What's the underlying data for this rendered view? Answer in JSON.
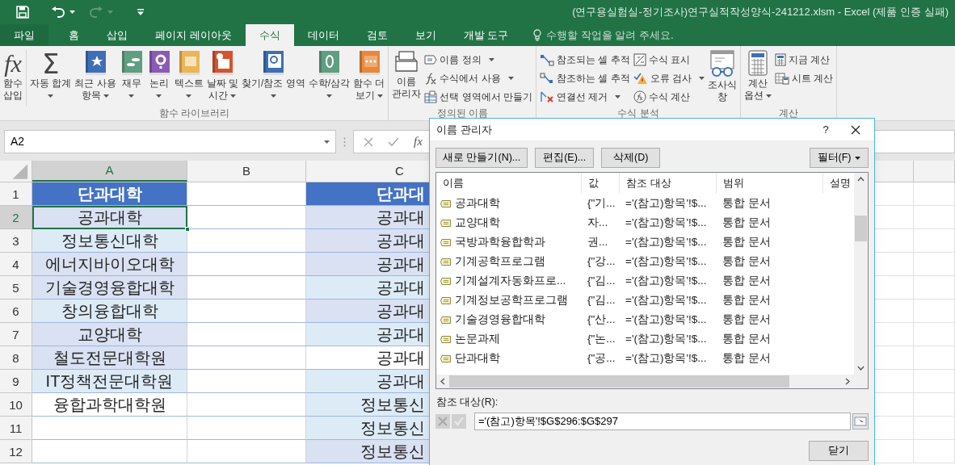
{
  "title_bar": {
    "title": "(연구용실험실-정기조사)연구실적작성양식-241212.xlsm - Excel (제품 인증 실패)"
  },
  "ribbon_tabs": [
    {
      "label": "파일",
      "kind": "file",
      "selected": false
    },
    {
      "label": "홈",
      "kind": "tab",
      "selected": false
    },
    {
      "label": "삽입",
      "kind": "tab",
      "selected": false
    },
    {
      "label": "페이지 레이아웃",
      "kind": "tab",
      "selected": false
    },
    {
      "label": "수식",
      "kind": "tab",
      "selected": true
    },
    {
      "label": "데이터",
      "kind": "tab",
      "selected": false
    },
    {
      "label": "검토",
      "kind": "tab",
      "selected": false
    },
    {
      "label": "보기",
      "kind": "tab",
      "selected": false
    },
    {
      "label": "개발 도구",
      "kind": "tab",
      "selected": false
    }
  ],
  "tell_me": {
    "placeholder": "수행할 작업을 알려 주세요."
  },
  "ribbon_groups": [
    {
      "label": "함수 라이브러리",
      "items": [
        {
          "kind": "large",
          "glyph": "fx",
          "lines": [
            "함수",
            "삽입"
          ],
          "dropdown": false
        },
        {
          "kind": "large",
          "glyph": "Σ",
          "lines": [
            "자동 합계"
          ],
          "dropdown": true
        },
        {
          "kind": "large",
          "lines": [
            "최근 사용",
            "항목"
          ],
          "dropdown": true
        },
        {
          "kind": "large",
          "lines": [
            "재무"
          ],
          "dropdown": true
        },
        {
          "kind": "large",
          "lines": [
            "논리"
          ],
          "dropdown": true
        },
        {
          "kind": "large",
          "lines": [
            "텍스트"
          ],
          "dropdown": true
        },
        {
          "kind": "large",
          "lines": [
            "날짜 및",
            "시간"
          ],
          "dropdown": true
        },
        {
          "kind": "large",
          "lines": [
            "찾기/참조 영역"
          ],
          "dropdown": true
        },
        {
          "kind": "large",
          "lines": [
            "수학/삼각"
          ],
          "dropdown": true
        },
        {
          "kind": "large",
          "lines": [
            "함수 더",
            "보기"
          ],
          "dropdown": true
        }
      ]
    },
    {
      "label": "정의된 이름",
      "items": [
        {
          "kind": "large",
          "lines": [
            "이름",
            "관리자"
          ],
          "dropdown": false
        },
        {
          "kind": "small",
          "lines": [
            "이름 정의"
          ],
          "dropdown": true
        },
        {
          "kind": "small",
          "lines": [
            "수식에서 사용"
          ],
          "dropdown": true
        },
        {
          "kind": "small",
          "lines": [
            "선택 영역에서 만들기"
          ],
          "dropdown": false
        }
      ]
    },
    {
      "label": "수식 분석",
      "items": [
        {
          "kind": "small",
          "lines": [
            "참조되는 셀 추적"
          ],
          "dropdown": false
        },
        {
          "kind": "small",
          "lines": [
            "참조하는 셀 추적"
          ],
          "dropdown": false
        },
        {
          "kind": "small",
          "lines": [
            "연결선 제거"
          ],
          "dropdown": true
        },
        {
          "kind": "small",
          "lines": [
            "수식 표시"
          ],
          "dropdown": false
        },
        {
          "kind": "small",
          "lines": [
            "오류 검사"
          ],
          "dropdown": true
        },
        {
          "kind": "small",
          "lines": [
            "수식 계산"
          ],
          "dropdown": false
        },
        {
          "kind": "large",
          "lines": [
            "조사식",
            "창"
          ],
          "dropdown": false
        }
      ]
    },
    {
      "label": "계산",
      "items": [
        {
          "kind": "large",
          "lines": [
            "계산",
            "옵션"
          ],
          "dropdown": true
        },
        {
          "kind": "small",
          "lines": [
            "지금 계산"
          ],
          "dropdown": false
        },
        {
          "kind": "small",
          "lines": [
            "시트 계산"
          ],
          "dropdown": false
        }
      ]
    }
  ],
  "formula_bar": {
    "name_box": "A2",
    "fx": "fx"
  },
  "sheet": {
    "columns": [
      {
        "label": "A",
        "selected": true
      },
      {
        "label": "B",
        "selected": false
      },
      {
        "label": "C",
        "selected": false
      }
    ],
    "rows": [
      {
        "number": "1",
        "kind": "header",
        "selected": false,
        "cells": [
          {
            "text": "단과대학",
            "color": "#4472c4"
          },
          null,
          {
            "text": "단과대",
            "color": "#4472c4"
          }
        ]
      },
      {
        "number": "2",
        "kind": "data",
        "selected": true,
        "cells": [
          {
            "text": "공과대학",
            "color": "#d9e1f2"
          },
          null,
          {
            "text": "공과대",
            "color": "#d9e1f2"
          }
        ]
      },
      {
        "number": "3",
        "kind": "data",
        "selected": false,
        "cells": [
          {
            "text": "정보통신대학",
            "color": "#ddebf7"
          },
          null,
          {
            "text": "공과대",
            "color": "#d9e1f2"
          }
        ]
      },
      {
        "number": "4",
        "kind": "data",
        "selected": false,
        "cells": [
          {
            "text": "에너지바이오대학",
            "color": "#d9e1f2"
          },
          null,
          {
            "text": "공과대",
            "color": "#d9e1f2"
          }
        ]
      },
      {
        "number": "5",
        "kind": "data",
        "selected": false,
        "cells": [
          {
            "text": "기술경영융합대학",
            "color": "#d9e1f2"
          },
          null,
          {
            "text": "공과대",
            "color": "#ddebf7"
          }
        ]
      },
      {
        "number": "6",
        "kind": "data",
        "selected": false,
        "cells": [
          {
            "text": "창의융합대학",
            "color": "#ddebf7"
          },
          null,
          {
            "text": "공과대",
            "color": "#d9e1f2"
          }
        ]
      },
      {
        "number": "7",
        "kind": "data",
        "selected": false,
        "cells": [
          {
            "text": "교양대학",
            "color": "#d9e1f2"
          },
          null,
          {
            "text": "공과대",
            "color": "#ddebf7"
          }
        ]
      },
      {
        "number": "8",
        "kind": "data",
        "selected": false,
        "cells": [
          {
            "text": "철도전문대학원",
            "color": "#d9e1f2"
          },
          null,
          {
            "text": "공과대"
          }
        ]
      },
      {
        "number": "9",
        "kind": "data",
        "selected": false,
        "cells": [
          {
            "text": "IT정책전문대학원",
            "color": "#ddebf7"
          },
          null,
          {
            "text": "공과대",
            "color": "#ddebf7"
          }
        ]
      },
      {
        "number": "10",
        "kind": "data",
        "selected": false,
        "cells": [
          {
            "text": "융합과학대학원"
          },
          null,
          {
            "text": "정보통신",
            "color": "#ddebf7"
          }
        ]
      },
      {
        "number": "11",
        "kind": "data",
        "selected": false,
        "cells": [
          null,
          null,
          {
            "text": "정보통신",
            "color": "#ddebf7"
          }
        ]
      },
      {
        "number": "12",
        "kind": "data",
        "selected": false,
        "cells": [
          null,
          null,
          {
            "text": "정보통신",
            "color": "#d9e1f2"
          }
        ]
      }
    ]
  },
  "name_manager": {
    "title": "이름 관리자",
    "help": "?",
    "buttons": [
      "새로 만들기(N)...",
      "편집(E)...",
      "삭제(D)"
    ],
    "filter_button": "필터(F)",
    "columns": [
      "이름",
      "값",
      "참조 대상",
      "범위",
      "설명"
    ],
    "rows": [
      {
        "name": "공과대학",
        "value": "{\"기...",
        "refers_to": "='(참고)항목'!$...",
        "scope": "통합 문서"
      },
      {
        "name": "교양대학",
        "value": "자...",
        "refers_to": "='(참고)항목'!$...",
        "scope": "통합 문서"
      },
      {
        "name": "국방과학융합학과",
        "value": "권...",
        "refers_to": "='(참고)항목'!$...",
        "scope": "통합 문서"
      },
      {
        "name": "기계공학프로그램",
        "value": "{\"강...",
        "refers_to": "='(참고)항목'!$...",
        "scope": "통합 문서"
      },
      {
        "name": "기계설계자동화프로...",
        "value": "{\"김...",
        "refers_to": "='(참고)항목'!$...",
        "scope": "통합 문서"
      },
      {
        "name": "기계정보공학프로그램",
        "value": "{\"김...",
        "refers_to": "='(참고)항목'!$...",
        "scope": "통합 문서"
      },
      {
        "name": "기술경영융합대학",
        "value": "{\"산...",
        "refers_to": "='(참고)항목'!$...",
        "scope": "통합 문서"
      },
      {
        "name": "논문과제",
        "value": "{\"논...",
        "refers_to": "='(참고)항목'!$...",
        "scope": "통합 문서"
      },
      {
        "name": "단과대학",
        "value": "{\"공...",
        "refers_to": "='(참고)항목'!$...",
        "scope": "통합 문서"
      }
    ],
    "refers_to_label": "참조 대상(R):",
    "refers_to_value": "='(참고)항목'!$G$296:$G$297",
    "edit_controls_disabled": true,
    "close_button": "닫기"
  }
}
